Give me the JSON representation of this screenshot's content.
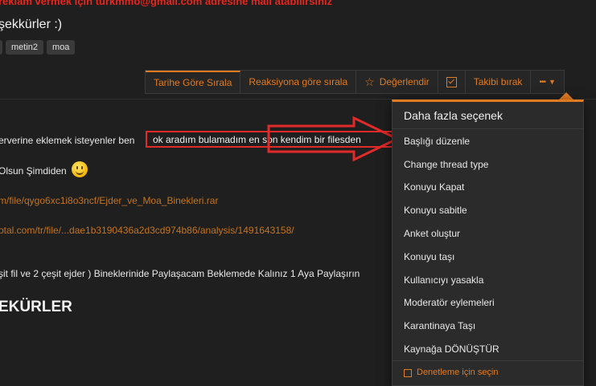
{
  "post": {
    "ad_line": "reklam vermek için turkmmo@gmail.com adresine mail atabilirsiniz",
    "thanks": "şekkürler :)",
    "tags": [
      "",
      "metin2",
      "moa"
    ],
    "line1_prefix": "erverine eklemek isteyenler ben",
    "line1_highlight": "ok aradım bulamadım en son kendim bir filesden",
    "line2": "Olsun Şimdiden",
    "link1": "m/file/qygo6xc1i8o3ncf/Ejder_ve_Moa_Binekleri.rar",
    "link2": "otal.com/tr/file/...dae1b3190436a2d3cd974b86/analysis/1491643158/",
    "line3": "şit fil ve 2 çeşit ejder ) Bineklerinide Paylaşacam Beklemede Kalınız 1 Aya Paylaşırın",
    "heading": "EKÜRLER"
  },
  "toolbar": {
    "sort_date": "Tarihe Göre Sırala",
    "sort_reaction": "Reaksiyona göre sırala",
    "rate": "Değerlendir",
    "unfollow": "Takibi bırak",
    "more": "•••"
  },
  "menu": {
    "title": "Daha fazla seçenek",
    "items": [
      "Başlığı düzenle",
      "Change thread type",
      "Konuyu Kapat",
      "Konuyu sabitle",
      "Anket oluştur",
      "Konuyu taşı",
      "Kullanıcıyı yasakla",
      "Moderatör eylemeleri",
      "Karantinaya Taşı",
      "Kaynağa DÖNÜŞTÜR"
    ],
    "select_label": "Denetleme için seçin"
  },
  "colors": {
    "accent": "#e07b22",
    "ad_red": "#e8261e",
    "annotation_red": "#e12a2a",
    "background": "#1f1f1f"
  }
}
